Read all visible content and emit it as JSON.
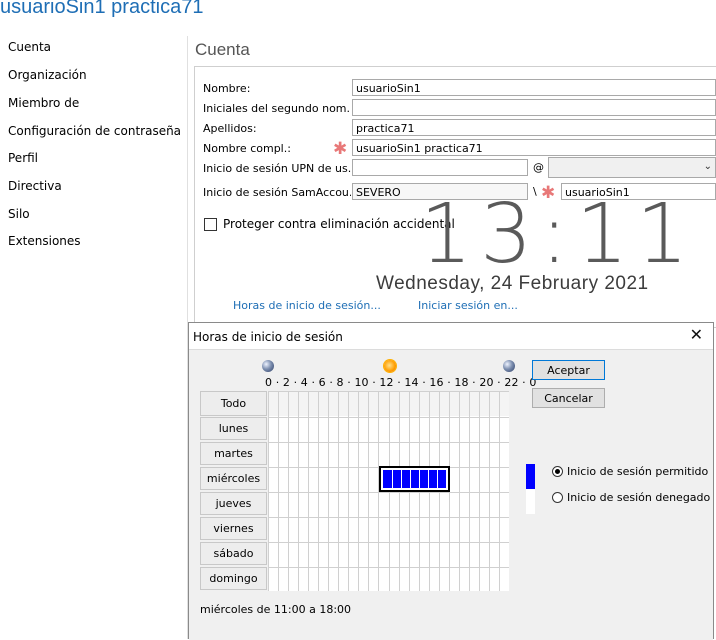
{
  "window": {
    "title": "usuarioSin1 practica71"
  },
  "sidebar": {
    "items": [
      {
        "label": "Cuenta"
      },
      {
        "label": "Organización"
      },
      {
        "label": "Miembro de"
      },
      {
        "label": "Configuración de contraseña"
      },
      {
        "label": "Perfil"
      },
      {
        "label": "Directiva"
      },
      {
        "label": "Silo"
      },
      {
        "label": "Extensiones"
      }
    ]
  },
  "account": {
    "section_title": "Cuenta",
    "fields": {
      "nombre": {
        "label": "Nombre:",
        "value": "usuarioSin1"
      },
      "iniciales": {
        "label": "Iniciales del segundo nom...",
        "value": ""
      },
      "apellidos": {
        "label": "Apellidos:",
        "value": "practica71"
      },
      "nombre_completo": {
        "label": "Nombre compl.:",
        "value": "usuarioSin1 practica71"
      },
      "upn": {
        "label": "Inicio de sesión UPN de us...",
        "value": "",
        "at_symbol": "@",
        "domain": ""
      },
      "sam": {
        "label": "Inicio de sesión SamAccou...",
        "domain": "SEVERO",
        "separator": "\\",
        "value": "usuarioSin1"
      }
    },
    "protect_checkbox": {
      "label": "Proteger contra eliminación accidental",
      "checked": false
    },
    "links": {
      "logon_hours": "Horas de inicio de sesión...",
      "logon_to": "Iniciar sesión en..."
    }
  },
  "clock": {
    "time": "13:11",
    "date": "Wednesday, 24 February 2021"
  },
  "dialog": {
    "title": "Horas de inicio de sesión",
    "close_glyph": "✕",
    "hours_header": "0 · 2 · 4 · 6 · 8 · 10 · 12 · 14 · 16 · 18 · 20 · 22 · 0",
    "all_label": "Todo",
    "days": [
      "lunes",
      "martes",
      "miércoles",
      "jueves",
      "viernes",
      "sábado",
      "domingo"
    ],
    "selection": {
      "day": "miércoles",
      "from_hour": 11,
      "to_hour": 18
    },
    "buttons": {
      "accept": "Aceptar",
      "cancel": "Cancelar"
    },
    "radios": {
      "allowed": {
        "label": "Inicio de sesión permitido",
        "selected": true
      },
      "denied": {
        "label": "Inicio de sesión denegado",
        "selected": false
      }
    },
    "status": "miércoles de 11:00 a 18:00",
    "colors": {
      "allowed": "#0000ff",
      "denied": "#ffffff",
      "grid_line": "#d0d0d0"
    },
    "icons": {
      "midnight": "moon-icon",
      "noon": "sun-icon"
    }
  }
}
